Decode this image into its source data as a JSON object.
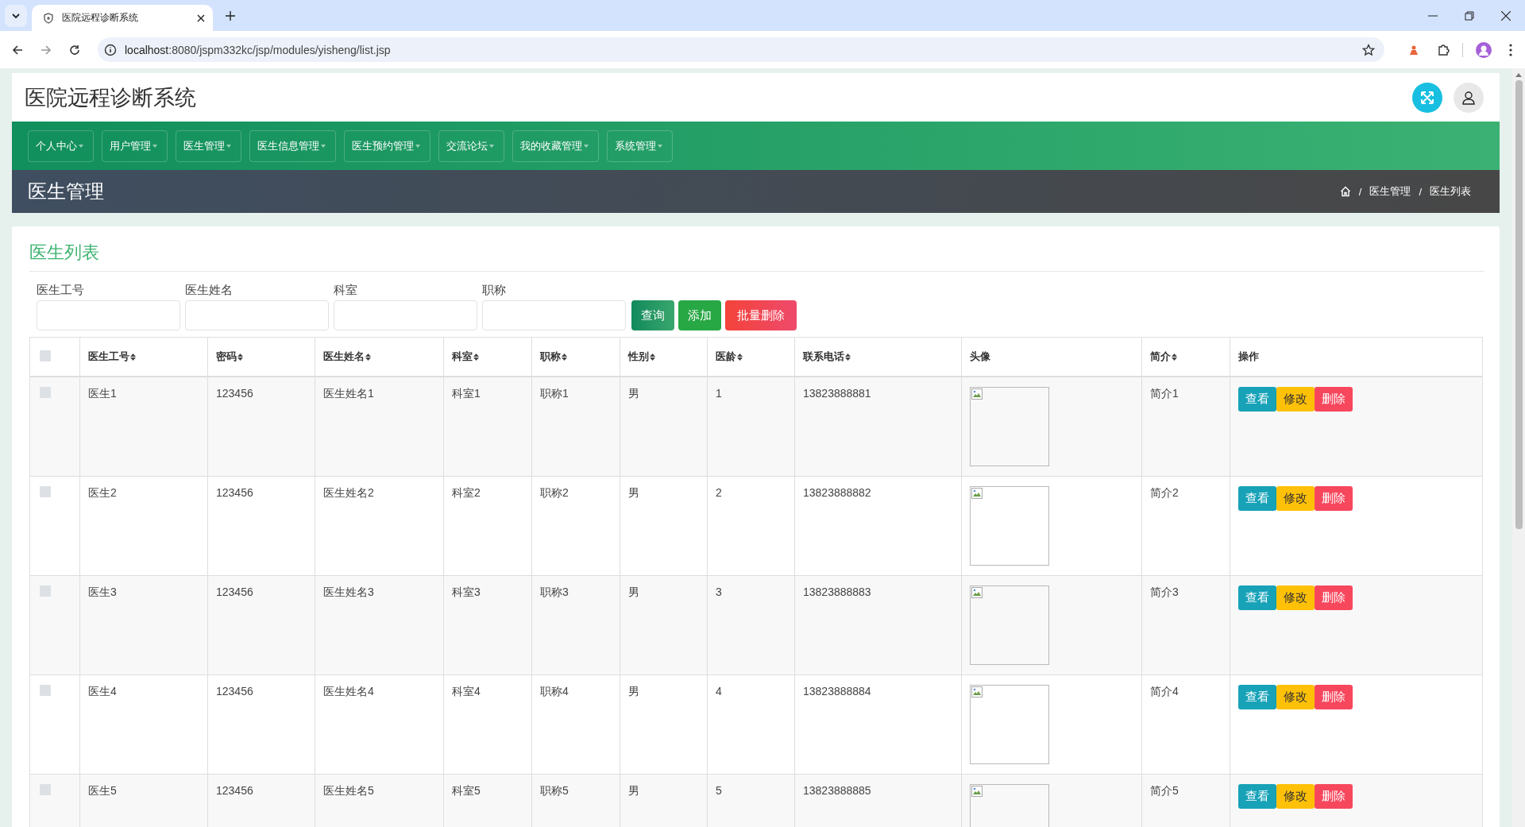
{
  "browser": {
    "tab_title": "医院远程诊断系统",
    "url_host": "localhost",
    "url_rest": ":8080/jspm332kc/jsp/modules/yisheng/list.jsp"
  },
  "header": {
    "title": "医院远程诊断系统"
  },
  "nav": {
    "items": [
      {
        "label": "个人中心",
        "dropdown": true
      },
      {
        "label": "用户管理",
        "dropdown": true
      },
      {
        "label": "医生管理",
        "dropdown": true
      },
      {
        "label": "医生信息管理",
        "dropdown": true
      },
      {
        "label": "医生预约管理",
        "dropdown": true
      },
      {
        "label": "交流论坛",
        "dropdown": true
      },
      {
        "label": "我的收藏管理",
        "dropdown": true
      },
      {
        "label": "系统管理",
        "dropdown": true
      }
    ]
  },
  "page_title": "医生管理",
  "breadcrumb": {
    "separator": "/",
    "items": [
      "医生管理",
      "医生列表"
    ]
  },
  "card": {
    "title": "医生列表",
    "search": {
      "fields": [
        {
          "label": "医生工号"
        },
        {
          "label": "医生姓名"
        },
        {
          "label": "科室"
        },
        {
          "label": "职称"
        }
      ],
      "buttons": [
        {
          "label": "查询",
          "kind": "search"
        },
        {
          "label": "添加",
          "kind": "add"
        },
        {
          "label": "批量删除",
          "kind": "delete"
        }
      ]
    },
    "table": {
      "header_checked": false,
      "columns": [
        {
          "label": "医生工号",
          "kind": "text",
          "sortable": true
        },
        {
          "label": "密码",
          "kind": "text",
          "sortable": true
        },
        {
          "label": "医生姓名",
          "kind": "text",
          "sortable": true
        },
        {
          "label": "科室",
          "kind": "text",
          "sortable": true
        },
        {
          "label": "职称",
          "kind": "text",
          "sortable": true
        },
        {
          "label": "性别",
          "kind": "text",
          "sortable": true
        },
        {
          "label": "医龄",
          "kind": "text",
          "sortable": true
        },
        {
          "label": "联系电话",
          "kind": "text",
          "sortable": true
        },
        {
          "label": "头像",
          "kind": "image",
          "sortable": false
        },
        {
          "label": "简介",
          "kind": "text",
          "sortable": true
        },
        {
          "label": "操作",
          "kind": "actions",
          "sortable": false
        }
      ],
      "rows": [
        {
          "checked": false,
          "values": [
            "医生1",
            "123456",
            "医生姓名1",
            "科室1",
            "职称1",
            "男",
            "1",
            "13823888881",
            "简介1"
          ],
          "actions": [
            {
              "label": "查看",
              "kind": "view"
            },
            {
              "label": "修改",
              "kind": "edit"
            },
            {
              "label": "删除",
              "kind": "delete"
            }
          ]
        },
        {
          "checked": false,
          "values": [
            "医生2",
            "123456",
            "医生姓名2",
            "科室2",
            "职称2",
            "男",
            "2",
            "13823888882",
            "简介2"
          ],
          "actions": [
            {
              "label": "查看",
              "kind": "view"
            },
            {
              "label": "修改",
              "kind": "edit"
            },
            {
              "label": "删除",
              "kind": "delete"
            }
          ]
        },
        {
          "checked": false,
          "values": [
            "医生3",
            "123456",
            "医生姓名3",
            "科室3",
            "职称3",
            "男",
            "3",
            "13823888883",
            "简介3"
          ],
          "actions": [
            {
              "label": "查看",
              "kind": "view"
            },
            {
              "label": "修改",
              "kind": "edit"
            },
            {
              "label": "删除",
              "kind": "delete"
            }
          ]
        },
        {
          "checked": false,
          "values": [
            "医生4",
            "123456",
            "医生姓名4",
            "科室4",
            "职称4",
            "男",
            "4",
            "13823888884",
            "简介4"
          ],
          "actions": [
            {
              "label": "查看",
              "kind": "view"
            },
            {
              "label": "修改",
              "kind": "edit"
            },
            {
              "label": "删除",
              "kind": "delete"
            }
          ]
        },
        {
          "checked": false,
          "values": [
            "医生5",
            "123456",
            "医生姓名5",
            "科室5",
            "职称5",
            "男",
            "5",
            "13823888885",
            "简介5"
          ],
          "actions": [
            {
              "label": "查看",
              "kind": "view"
            },
            {
              "label": "修改",
              "kind": "edit"
            },
            {
              "label": "删除",
              "kind": "delete"
            }
          ]
        }
      ]
    }
  }
}
